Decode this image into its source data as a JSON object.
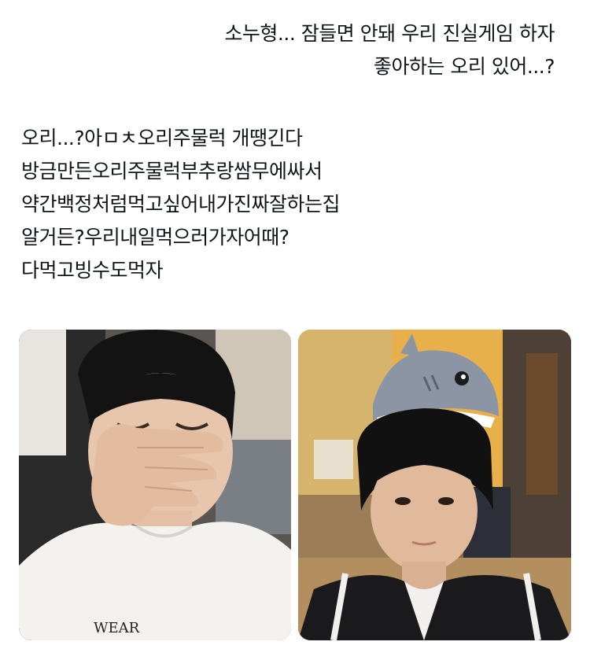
{
  "tweet": {
    "quote_lines": [
      "소누형... 잠들면 안돼 우리 진실게임 하자",
      "좋아하는 오리 있어...?"
    ],
    "reply_lines": [
      "오리...?아ㅁㅊ오리주물럭 개땡긴다",
      "방금만든오리주물럭부추랑쌈무에싸서",
      "약간백정처럼먹고싶어내가진짜잘하는집",
      "알거든?우리내일먹으러가자어때?",
      "다먹고빙수도먹자"
    ]
  },
  "media": {
    "photos": [
      {
        "name": "photo-boy-covering-mouth",
        "shirt_text": "WEAR"
      },
      {
        "name": "photo-boy-with-shark-hat"
      }
    ]
  }
}
